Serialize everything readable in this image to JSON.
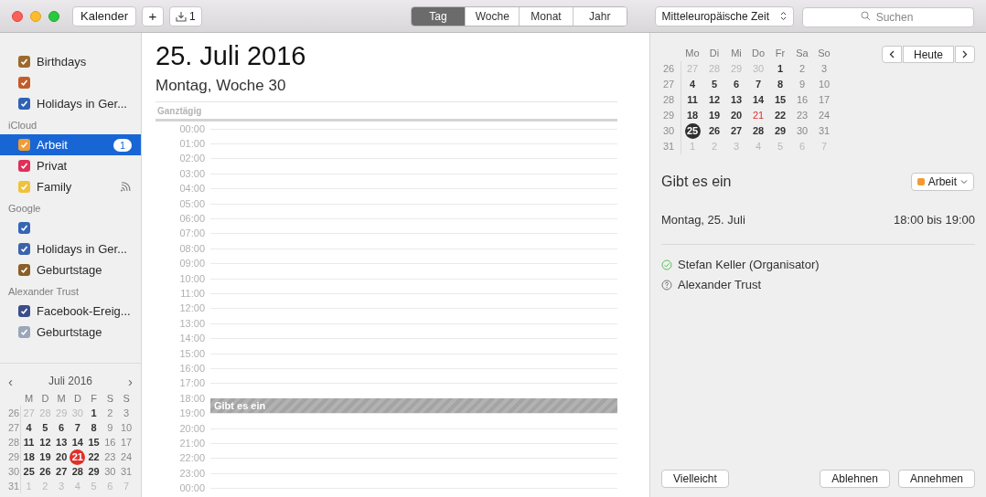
{
  "toolbar": {
    "calendars_button": "Kalender",
    "add_button": "+",
    "inbox_count": "1",
    "views": [
      {
        "label": "Tag",
        "selected": true
      },
      {
        "label": "Woche",
        "selected": false
      },
      {
        "label": "Monat",
        "selected": false
      },
      {
        "label": "Jahr",
        "selected": false
      }
    ],
    "timezone": "Mitteleuropäische Zeit",
    "search": {
      "placeholder": "Suchen"
    }
  },
  "sidebar": {
    "groups": [
      {
        "items": [
          {
            "label": "Birthdays",
            "color": "#9c6a2c",
            "checked": true,
            "selected": false
          },
          {
            "color": "#c25c28",
            "checked": true,
            "selected": false
          },
          {
            "label": "Holidays in Ger...",
            "color": "#2f62b4",
            "checked": true,
            "selected": false
          }
        ]
      },
      {
        "title": "iCloud",
        "items": [
          {
            "label": "Arbeit",
            "color": "#f39a32",
            "checked": true,
            "selected": true,
            "badge": "1"
          },
          {
            "label": "Privat",
            "color": "#e0305a",
            "checked": true,
            "selected": false
          },
          {
            "label": "Family",
            "color": "#f0c23a",
            "checked": true,
            "selected": false,
            "shared": true
          }
        ]
      },
      {
        "title": "Google",
        "items": [
          {
            "color": "#3466b5",
            "checked": true,
            "selected": false
          },
          {
            "label": "Holidays in Ger...",
            "color": "#3a63ad",
            "checked": true,
            "selected": false
          },
          {
            "label": "Geburtstage",
            "color": "#8a5e26",
            "checked": true,
            "selected": false
          }
        ]
      },
      {
        "title": "Alexander Trust",
        "items": [
          {
            "label": "Facebook-Ereig...",
            "color": "#3b4d8a",
            "checked": true,
            "selected": false
          },
          {
            "label": "Geburtstage",
            "color": "#9aa6ba",
            "checked": true,
            "selected": false
          }
        ]
      }
    ]
  },
  "mini_calendar": {
    "title": "Juli 2016",
    "prev": "‹",
    "next": "›",
    "weekdays": [
      "M",
      "D",
      "M",
      "D",
      "F",
      "S",
      "S"
    ],
    "weeks": [
      {
        "week": "26",
        "days": [
          {
            "d": "27",
            "muted": true,
            "today": false,
            "selected": false
          },
          {
            "d": "28",
            "muted": true,
            "today": false,
            "selected": false
          },
          {
            "d": "29",
            "muted": true,
            "today": false,
            "selected": false
          },
          {
            "d": "30",
            "muted": true,
            "today": false,
            "selected": false
          },
          {
            "d": "1",
            "muted": false,
            "today": false,
            "selected": false
          },
          {
            "d": "2",
            "muted": false,
            "today": false,
            "selected": false
          },
          {
            "d": "3",
            "muted": false,
            "today": false,
            "selected": false
          }
        ]
      },
      {
        "week": "27",
        "days": [
          {
            "d": "4",
            "muted": false,
            "today": false,
            "selected": false
          },
          {
            "d": "5",
            "muted": false,
            "today": false,
            "selected": false
          },
          {
            "d": "6",
            "muted": false,
            "today": false,
            "selected": false
          },
          {
            "d": "7",
            "muted": false,
            "today": false,
            "selected": false
          },
          {
            "d": "8",
            "muted": false,
            "today": false,
            "selected": false
          },
          {
            "d": "9",
            "muted": false,
            "today": false,
            "selected": false
          },
          {
            "d": "10",
            "muted": false,
            "today": false,
            "selected": false
          }
        ]
      },
      {
        "week": "28",
        "days": [
          {
            "d": "11",
            "muted": false,
            "today": false,
            "selected": false
          },
          {
            "d": "12",
            "muted": false,
            "today": false,
            "selected": false
          },
          {
            "d": "13",
            "muted": false,
            "today": false,
            "selected": false
          },
          {
            "d": "14",
            "muted": false,
            "today": false,
            "selected": false
          },
          {
            "d": "15",
            "muted": false,
            "today": false,
            "selected": false
          },
          {
            "d": "16",
            "muted": false,
            "today": false,
            "selected": false
          },
          {
            "d": "17",
            "muted": false,
            "today": false,
            "selected": false
          }
        ]
      },
      {
        "week": "29",
        "days": [
          {
            "d": "18",
            "muted": false,
            "today": false,
            "selected": false
          },
          {
            "d": "19",
            "muted": false,
            "today": false,
            "selected": false
          },
          {
            "d": "20",
            "muted": false,
            "today": false,
            "selected": false
          },
          {
            "d": "21",
            "muted": false,
            "today": true,
            "selected": true
          },
          {
            "d": "22",
            "muted": false,
            "today": false,
            "selected": false
          },
          {
            "d": "23",
            "muted": false,
            "today": false,
            "selected": false
          },
          {
            "d": "24",
            "muted": false,
            "today": false,
            "selected": false
          }
        ]
      },
      {
        "week": "30",
        "days": [
          {
            "d": "25",
            "muted": false,
            "today": false,
            "selected": false
          },
          {
            "d": "26",
            "muted": false,
            "today": false,
            "selected": false
          },
          {
            "d": "27",
            "muted": false,
            "today": false,
            "selected": false
          },
          {
            "d": "28",
            "muted": false,
            "today": false,
            "selected": false
          },
          {
            "d": "29",
            "muted": false,
            "today": false,
            "selected": false
          },
          {
            "d": "30",
            "muted": false,
            "today": false,
            "selected": false
          },
          {
            "d": "31",
            "muted": false,
            "today": false,
            "selected": false
          }
        ]
      },
      {
        "week": "31",
        "days": [
          {
            "d": "1",
            "muted": true,
            "today": false,
            "selected": false
          },
          {
            "d": "2",
            "muted": true,
            "today": false,
            "selected": false
          },
          {
            "d": "3",
            "muted": true,
            "today": false,
            "selected": false
          },
          {
            "d": "4",
            "muted": true,
            "today": false,
            "selected": false
          },
          {
            "d": "5",
            "muted": true,
            "today": false,
            "selected": false
          },
          {
            "d": "6",
            "muted": true,
            "today": false,
            "selected": false
          },
          {
            "d": "7",
            "muted": true,
            "today": false,
            "selected": false
          }
        ]
      }
    ]
  },
  "day_view": {
    "date": "25. Juli 2016",
    "subtitle": "Montag, Woche 30",
    "all_day_label": "Ganztägig",
    "hours": [
      {
        "label": "00:00"
      },
      {
        "label": "01:00"
      },
      {
        "label": "02:00"
      },
      {
        "label": "03:00"
      },
      {
        "label": "04:00"
      },
      {
        "label": "05:00"
      },
      {
        "label": "06:00"
      },
      {
        "label": "07:00"
      },
      {
        "label": "08:00"
      },
      {
        "label": "09:00"
      },
      {
        "label": "10:00"
      },
      {
        "label": "11:00"
      },
      {
        "label": "12:00"
      },
      {
        "label": "13:00"
      },
      {
        "label": "14:00"
      },
      {
        "label": "15:00"
      },
      {
        "label": "16:00"
      },
      {
        "label": "17:00"
      },
      {
        "label": "18:00",
        "event": {
          "title": "Gibt es ein"
        }
      },
      {
        "label": "19:00"
      },
      {
        "label": "20:00"
      },
      {
        "label": "21:00"
      },
      {
        "label": "22:00"
      },
      {
        "label": "23:00"
      },
      {
        "label": "00:00"
      }
    ]
  },
  "right_calendar": {
    "today_button": "Heute",
    "weekdays": [
      "Mo",
      "Di",
      "Mi",
      "Do",
      "Fr",
      "Sa",
      "So"
    ],
    "weeks": [
      {
        "week": "26",
        "days": [
          {
            "d": "27",
            "muted": true,
            "today": false,
            "selected": false
          },
          {
            "d": "28",
            "muted": true,
            "today": false,
            "selected": false
          },
          {
            "d": "29",
            "muted": true,
            "today": false,
            "selected": false
          },
          {
            "d": "30",
            "muted": true,
            "today": false,
            "selected": false
          },
          {
            "d": "1",
            "muted": false,
            "today": false,
            "selected": false
          },
          {
            "d": "2",
            "muted": false,
            "today": false,
            "selected": false
          },
          {
            "d": "3",
            "muted": false,
            "today": false,
            "selected": false
          }
        ]
      },
      {
        "week": "27",
        "days": [
          {
            "d": "4",
            "muted": false,
            "today": false,
            "selected": false
          },
          {
            "d": "5",
            "muted": false,
            "today": false,
            "selected": false
          },
          {
            "d": "6",
            "muted": false,
            "today": false,
            "selected": false
          },
          {
            "d": "7",
            "muted": false,
            "today": false,
            "selected": false
          },
          {
            "d": "8",
            "muted": false,
            "today": false,
            "selected": false
          },
          {
            "d": "9",
            "muted": false,
            "today": false,
            "selected": false
          },
          {
            "d": "10",
            "muted": false,
            "today": false,
            "selected": false
          }
        ]
      },
      {
        "week": "28",
        "days": [
          {
            "d": "11",
            "muted": false,
            "today": false,
            "selected": false
          },
          {
            "d": "12",
            "muted": false,
            "today": false,
            "selected": false
          },
          {
            "d": "13",
            "muted": false,
            "today": false,
            "selected": false
          },
          {
            "d": "14",
            "muted": false,
            "today": false,
            "selected": false
          },
          {
            "d": "15",
            "muted": false,
            "today": false,
            "selected": false
          },
          {
            "d": "16",
            "muted": false,
            "today": false,
            "selected": false
          },
          {
            "d": "17",
            "muted": false,
            "today": false,
            "selected": false
          }
        ]
      },
      {
        "week": "29",
        "days": [
          {
            "d": "18",
            "muted": false,
            "today": false,
            "selected": false
          },
          {
            "d": "19",
            "muted": false,
            "today": false,
            "selected": false
          },
          {
            "d": "20",
            "muted": false,
            "today": false,
            "selected": false
          },
          {
            "d": "21",
            "muted": false,
            "today": true,
            "selected": false
          },
          {
            "d": "22",
            "muted": false,
            "today": false,
            "selected": false
          },
          {
            "d": "23",
            "muted": false,
            "today": false,
            "selected": false
          },
          {
            "d": "24",
            "muted": false,
            "today": false,
            "selected": false
          }
        ]
      },
      {
        "week": "30",
        "days": [
          {
            "d": "25",
            "muted": false,
            "today": false,
            "selected": true
          },
          {
            "d": "26",
            "muted": false,
            "today": false,
            "selected": false
          },
          {
            "d": "27",
            "muted": false,
            "today": false,
            "selected": false
          },
          {
            "d": "28",
            "muted": false,
            "today": false,
            "selected": false
          },
          {
            "d": "29",
            "muted": false,
            "today": false,
            "selected": false
          },
          {
            "d": "30",
            "muted": false,
            "today": false,
            "selected": false
          },
          {
            "d": "31",
            "muted": false,
            "today": false,
            "selected": false
          }
        ]
      },
      {
        "week": "31",
        "days": [
          {
            "d": "1",
            "muted": true,
            "today": false,
            "selected": false
          },
          {
            "d": "2",
            "muted": true,
            "today": false,
            "selected": false
          },
          {
            "d": "3",
            "muted": true,
            "today": false,
            "selected": false
          },
          {
            "d": "4",
            "muted": true,
            "today": false,
            "selected": false
          },
          {
            "d": "5",
            "muted": true,
            "today": false,
            "selected": false
          },
          {
            "d": "6",
            "muted": true,
            "today": false,
            "selected": false
          },
          {
            "d": "7",
            "muted": true,
            "today": false,
            "selected": false
          }
        ]
      }
    ]
  },
  "event_detail": {
    "title": "Gibt es ein",
    "calendar": {
      "label": "Arbeit",
      "color": "#f39a32"
    },
    "date": "Montag, 25. Juli",
    "time": "18:00 bis 19:00",
    "attendees": [
      {
        "name": "Stefan Keller (Organisator)",
        "kind": "accepted"
      },
      {
        "name": "Alexander Trust",
        "kind": "unknown"
      }
    ],
    "buttons_left": [
      "Vielleicht"
    ],
    "buttons_right": [
      "Ablehnen",
      "Annehmen"
    ]
  }
}
